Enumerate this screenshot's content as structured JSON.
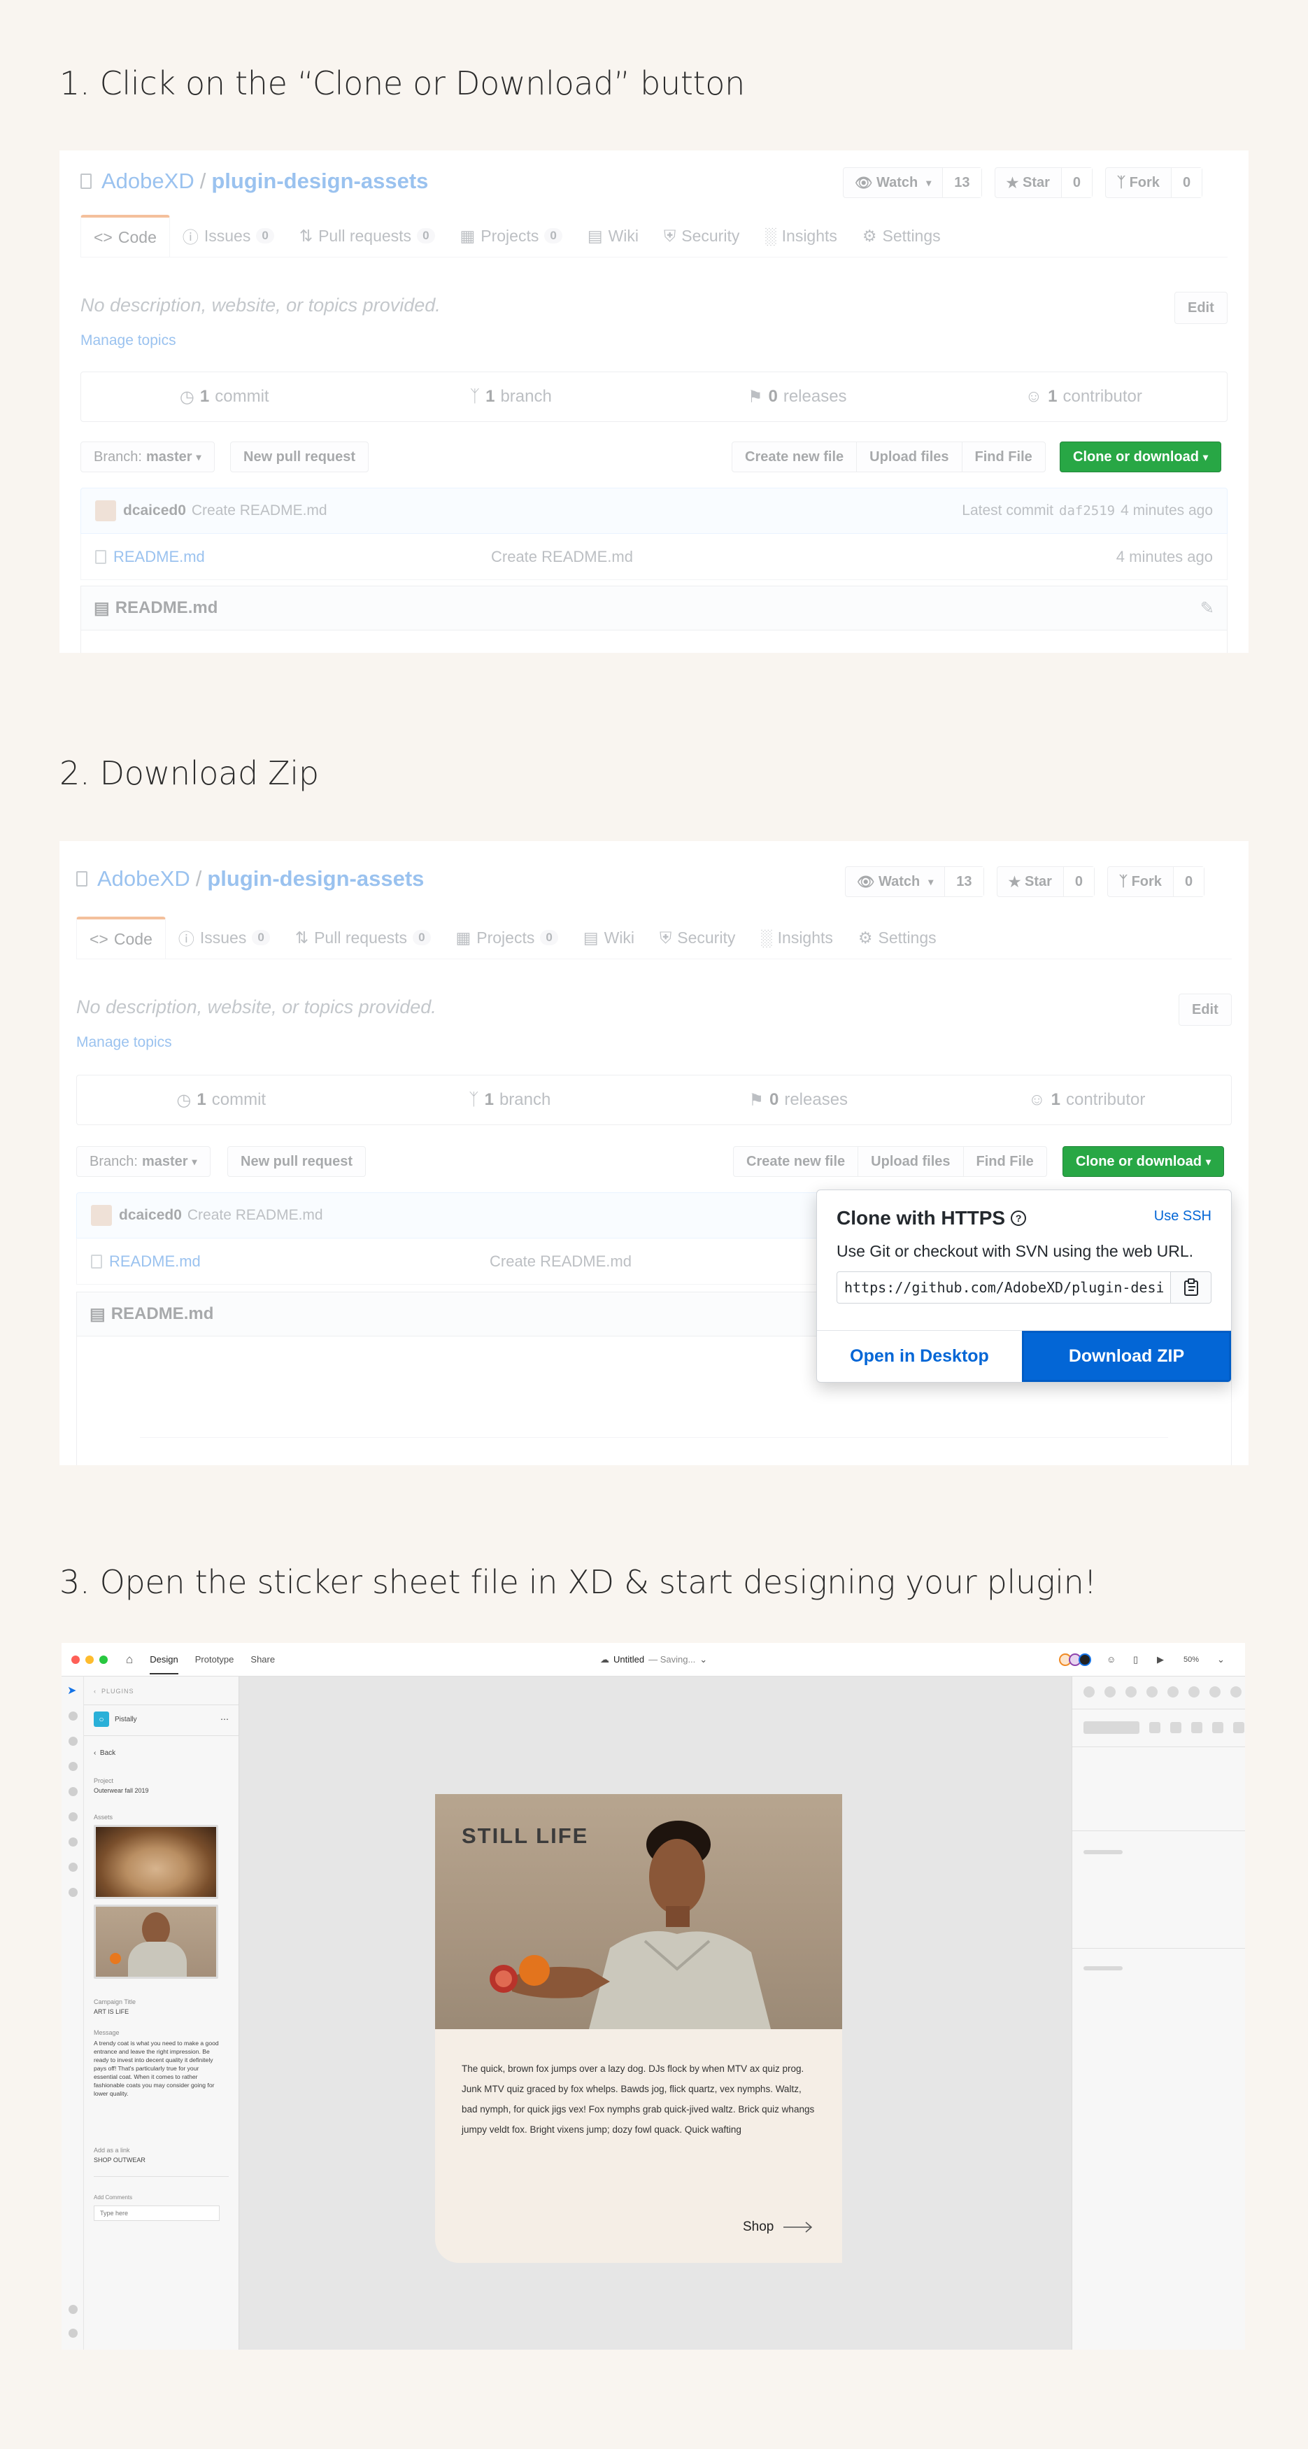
{
  "steps": {
    "s1": "1. Click on the “Clone or Download” button",
    "s2": "2. Download Zip",
    "s3": "3. Open the sticker sheet file in XD & start designing your plugin!"
  },
  "repo": {
    "owner": "AdobeXD",
    "sep": "/",
    "name": "plugin-design-assets",
    "watch_label": "Watch",
    "watch_count": "13",
    "star_label": "Star",
    "star_count": "0",
    "fork_label": "Fork",
    "fork_count": "0",
    "tabs": [
      {
        "label": "Code",
        "badge": ""
      },
      {
        "label": "Issues",
        "badge": "0"
      },
      {
        "label": "Pull requests",
        "badge": "0"
      },
      {
        "label": "Projects",
        "badge": "0"
      },
      {
        "label": "Wiki",
        "badge": ""
      },
      {
        "label": "Security",
        "badge": ""
      },
      {
        "label": "Insights",
        "badge": ""
      },
      {
        "label": "Settings",
        "badge": ""
      }
    ],
    "description": "No description, website, or topics provided.",
    "edit_label": "Edit",
    "manage_topics": "Manage topics",
    "stats": {
      "commits_n": "1",
      "commits_l": "commit",
      "branch_n": "1",
      "branch_l": "branch",
      "releases_n": "0",
      "releases_l": "releases",
      "contrib_n": "1",
      "contrib_l": "contributor"
    },
    "branch_prefix": "Branch:",
    "branch_value": "master",
    "new_pr": "New pull request",
    "create_file": "Create new file",
    "upload_files": "Upload files",
    "find_file": "Find File",
    "clone_btn": "Clone or download",
    "commit_user": "dcaiced0",
    "commit_msg": "Create README.md",
    "latest_commit": "Latest commit",
    "commit_hash": "daf2519",
    "commit_time": "4 minutes ago",
    "file_name": "README.md",
    "file_msg": "Create README.md",
    "file_time": "4 minutes ago",
    "readme_title": "README.md"
  },
  "popup": {
    "title": "Clone with HTTPS",
    "use_ssh": "Use SSH",
    "subtitle": "Use Git or checkout with SVN using the web URL.",
    "url": "https://github.com/AdobeXD/plugin-design-assets.git",
    "open_desktop": "Open in Desktop",
    "download_zip": "Download ZIP"
  },
  "xd": {
    "tab_design": "Design",
    "tab_prototype": "Prototype",
    "tab_share": "Share",
    "doc_title": "Untitled",
    "doc_status": "— Saving...",
    "zoom": "50%",
    "plugins_label": "PLUGINS",
    "plugin_name": "Pistally",
    "back_label": "Back",
    "project_label": "Project",
    "project_value": "Outerwear fall 2019",
    "assets_label": "Assets",
    "campaign_label": "Campaign Title",
    "campaign_value": "ART IS LIFE",
    "message_label": "Message",
    "message_value": "A trendy coat is what you need to make a good entrance and leave the right impression. Be ready to invest into decent quality it definitely pays off! That's particularly true for your essential coat. When it comes to rather fashionable coats you may consider going for lower quality.",
    "link_label": "Add as a link",
    "link_value": "SHOP OUTWEAR",
    "comments_label": "Add Comments",
    "comments_placeholder": "Type here",
    "card_title": "STILL LIFE",
    "card_body": "The quick, brown fox jumps over a lazy dog. DJs flock by when MTV ax quiz prog. Junk MTV quiz graced by fox whelps. Bawds jog, flick quartz, vex nymphs. Waltz, bad nymph, for quick jigs vex! Fox nymphs grab quick-jived waltz. Brick quiz whangs jumpy veldt fox. Bright vixens jump; dozy fowl quack. Quick wafting",
    "card_shop": "Shop"
  },
  "colors": {
    "bg": "#f9f5f0",
    "github_link": "#0366d6",
    "github_green": "#28a745",
    "xd_blue": "#1473e6"
  }
}
